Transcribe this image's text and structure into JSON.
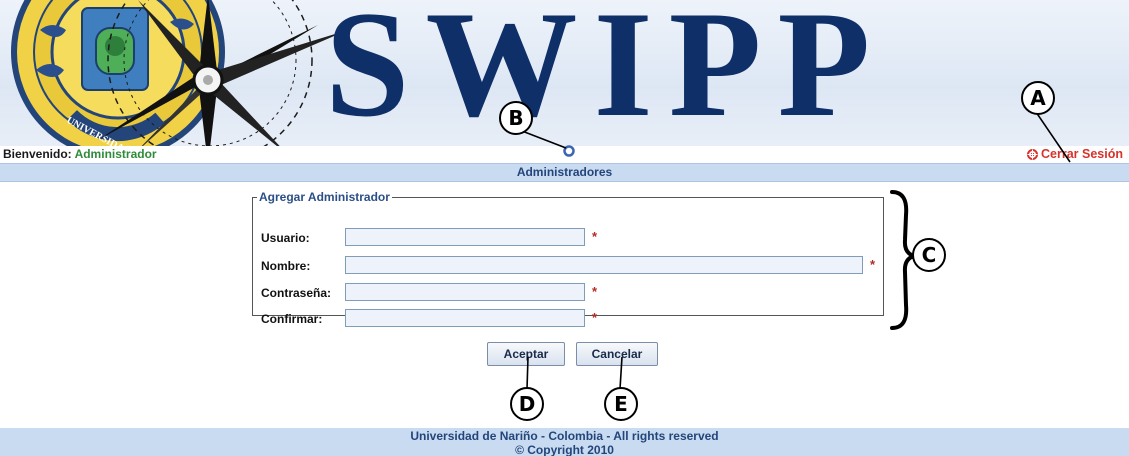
{
  "banner": {
    "title": "SWIPP"
  },
  "welcome": {
    "label": "Bienvenido:",
    "user": "Administrador"
  },
  "logout": {
    "label": "Cerrar Sesión"
  },
  "section": {
    "title": "Administradores"
  },
  "form": {
    "legend": "Agregar Administrador",
    "required_mark": "*",
    "fields": [
      {
        "label": "Usuario:",
        "value": ""
      },
      {
        "label": "Nombre:",
        "value": ""
      },
      {
        "label": "Contraseña:",
        "value": ""
      },
      {
        "label": "Confirmar:",
        "value": ""
      }
    ]
  },
  "buttons": {
    "accept": "Aceptar",
    "cancel": "Cancelar"
  },
  "footer": {
    "line1": "Universidad de Nariño - Colombia - All rights reserved",
    "line2": "© Copyright 2010"
  },
  "callouts": {
    "a": "A",
    "b": "B",
    "c": "C",
    "d": "D",
    "e": "E"
  },
  "colors": {
    "brand": "#0f2f69",
    "accent_bar": "#c9dbf1",
    "logout": "#d7332c",
    "user": "#2e8b3a",
    "required": "#b52a22"
  },
  "icons": {
    "logout": "logout-icon",
    "loading": "loading-icon",
    "seal": "university-seal",
    "compass": "compass-rose"
  }
}
